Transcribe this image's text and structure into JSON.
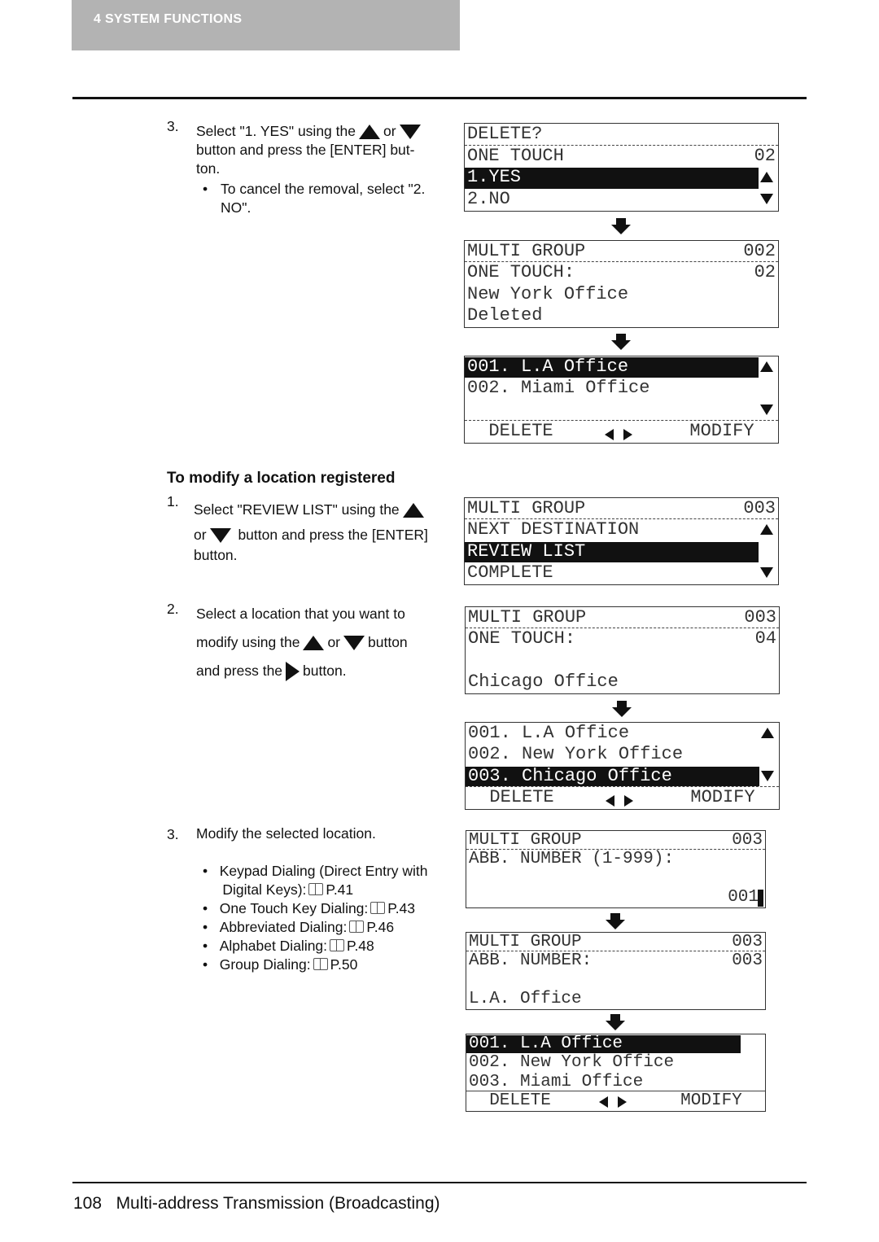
{
  "header": {
    "section": "4   SYSTEM FUNCTIONS"
  },
  "delete_steps": {
    "step3": {
      "num": "3.",
      "line1a": "Select \"1. YES\" using the",
      "or": "or",
      "line2": "button and press the [ENTER] but-",
      "line3": "ton.",
      "bullet": "To cancel the removal, select \"2.",
      "bullet2": "NO\"."
    }
  },
  "modify": {
    "heading": "To modify a location registered",
    "step1": {
      "num": "1.",
      "line1": "Select \"REVIEW LIST\" using the",
      "or": "or",
      "line2": "button and press the [ENTER]",
      "line3": "button."
    },
    "step2": {
      "num": "2.",
      "line1": "Select a location that you want to",
      "line2a": "modify using the",
      "or": "or",
      "line2b": "button",
      "line3a": "and press the",
      "line3b": "button."
    },
    "step3": {
      "num": "3.",
      "line1": "Modify the selected location.",
      "refs": [
        {
          "text": "Keypad Dialing (Direct Entry with",
          "text2": "Digital Keys):",
          "page": "P.41"
        },
        {
          "text": "One Touch Key Dialing:",
          "page": "P.43"
        },
        {
          "text": "Abbreviated Dialing:",
          "page": "P.46"
        },
        {
          "text": "Alphabet Dialing:",
          "page": "P.48"
        },
        {
          "text": "Group Dialing:",
          "page": "P.50"
        }
      ]
    }
  },
  "panels": [
    {
      "id": "p1",
      "font": 22,
      "rows": [
        {
          "l": "DELETE?",
          "div": "dashed"
        },
        {
          "l": "ONE TOUCH",
          "r": "02"
        },
        {
          "l": "1.YES",
          "hl": true,
          "arrow": "up"
        },
        {
          "l": "2.NO",
          "arrow": "down"
        }
      ]
    },
    {
      "id": "p2",
      "font": 22,
      "rows": [
        {
          "l": "MULTI GROUP",
          "r": "002",
          "div": "dashed"
        },
        {
          "l": "ONE TOUCH:",
          "r": "02"
        },
        {
          "l": "New York Office"
        },
        {
          "l": "Deleted"
        }
      ]
    },
    {
      "id": "p3",
      "font": 22,
      "rows": [
        {
          "l": "001. L.A Office",
          "hl": true,
          "arrow": "up"
        },
        {
          "l": "002. Miami Office"
        },
        {
          "l": "",
          "arrow": "down",
          "div": "dashed"
        },
        {
          "l": "  DELETE",
          "r": "MODIFY  ",
          "lr": true
        }
      ]
    },
    {
      "id": "p4",
      "font": 22,
      "rows": [
        {
          "l": "MULTI GROUP",
          "r": "003",
          "div": "dashed"
        },
        {
          "l": "NEXT DESTINATION",
          "arrow": "up"
        },
        {
          "l": "REVIEW LIST",
          "hl": true
        },
        {
          "l": "COMPLETE",
          "arrow": "down"
        }
      ]
    },
    {
      "id": "p5",
      "font": 22,
      "rows": [
        {
          "l": "MULTI GROUP",
          "r": "003",
          "div": "dashed"
        },
        {
          "l": "ONE TOUCH:",
          "r": "04"
        },
        {
          "l": ""
        },
        {
          "l": "Chicago Office"
        }
      ]
    },
    {
      "id": "p6",
      "font": 22,
      "rows": [
        {
          "l": "001. L.A Office",
          "arrow": "up"
        },
        {
          "l": "002. New York Office"
        },
        {
          "l": "003. Chicago Office",
          "hl": true,
          "arrow": "down",
          "div": "dashed"
        },
        {
          "l": "  DELETE",
          "r": "MODIFY  ",
          "lr": true
        }
      ]
    },
    {
      "id": "p7",
      "font": 21,
      "rows": [
        {
          "l": "MULTI GROUP",
          "r": "003",
          "div": "dashed"
        },
        {
          "l": "ABB. NUMBER (1-999):"
        },
        {
          "l": ""
        },
        {
          "l": "",
          "r": "001",
          "cursor": true
        }
      ]
    },
    {
      "id": "p8",
      "font": 21,
      "rows": [
        {
          "l": "MULTI GROUP",
          "r": "003",
          "div": "dashed"
        },
        {
          "l": "ABB. NUMBER:",
          "r": "003"
        },
        {
          "l": ""
        },
        {
          "l": "L.A. Office"
        }
      ]
    },
    {
      "id": "p9",
      "font": 21,
      "rows": [
        {
          "l": "001. L.A Office",
          "hl": true,
          "hlshort": true
        },
        {
          "l": "002. New York Office"
        },
        {
          "l": "003. Miami Office",
          "div": "solid"
        },
        {
          "l": "  DELETE",
          "r": "MODIFY  ",
          "lr": true
        }
      ]
    }
  ],
  "footer": {
    "page": "108",
    "title": "Multi-address Transmission (Broadcasting)"
  }
}
